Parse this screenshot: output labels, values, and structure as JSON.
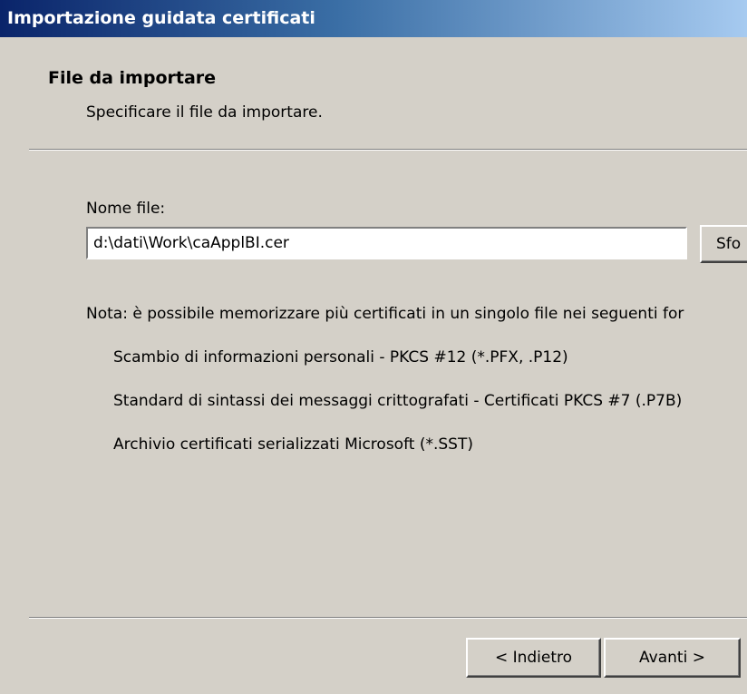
{
  "window": {
    "title": "Importazione guidata certificati"
  },
  "header": {
    "title": "File da importare",
    "subtitle": "Specificare il file da importare."
  },
  "file_field": {
    "label": "Nome file:",
    "value": "d:\\dati\\Work\\caApplBI.cer"
  },
  "browse_button": {
    "label": "Sfo"
  },
  "note": {
    "text": "Nota: è possibile memorizzare più certificati in un singolo file nei seguenti for",
    "formats": [
      "Scambio di informazioni personali - PKCS #12 (*.PFX, .P12)",
      "Standard di sintassi dei messaggi crittografati - Certificati PKCS #7 (.P7B)",
      "Archivio certificati serializzati Microsoft (*.SST)"
    ]
  },
  "navigation": {
    "back_label": "< Indietro",
    "next_label": "Avanti >"
  }
}
